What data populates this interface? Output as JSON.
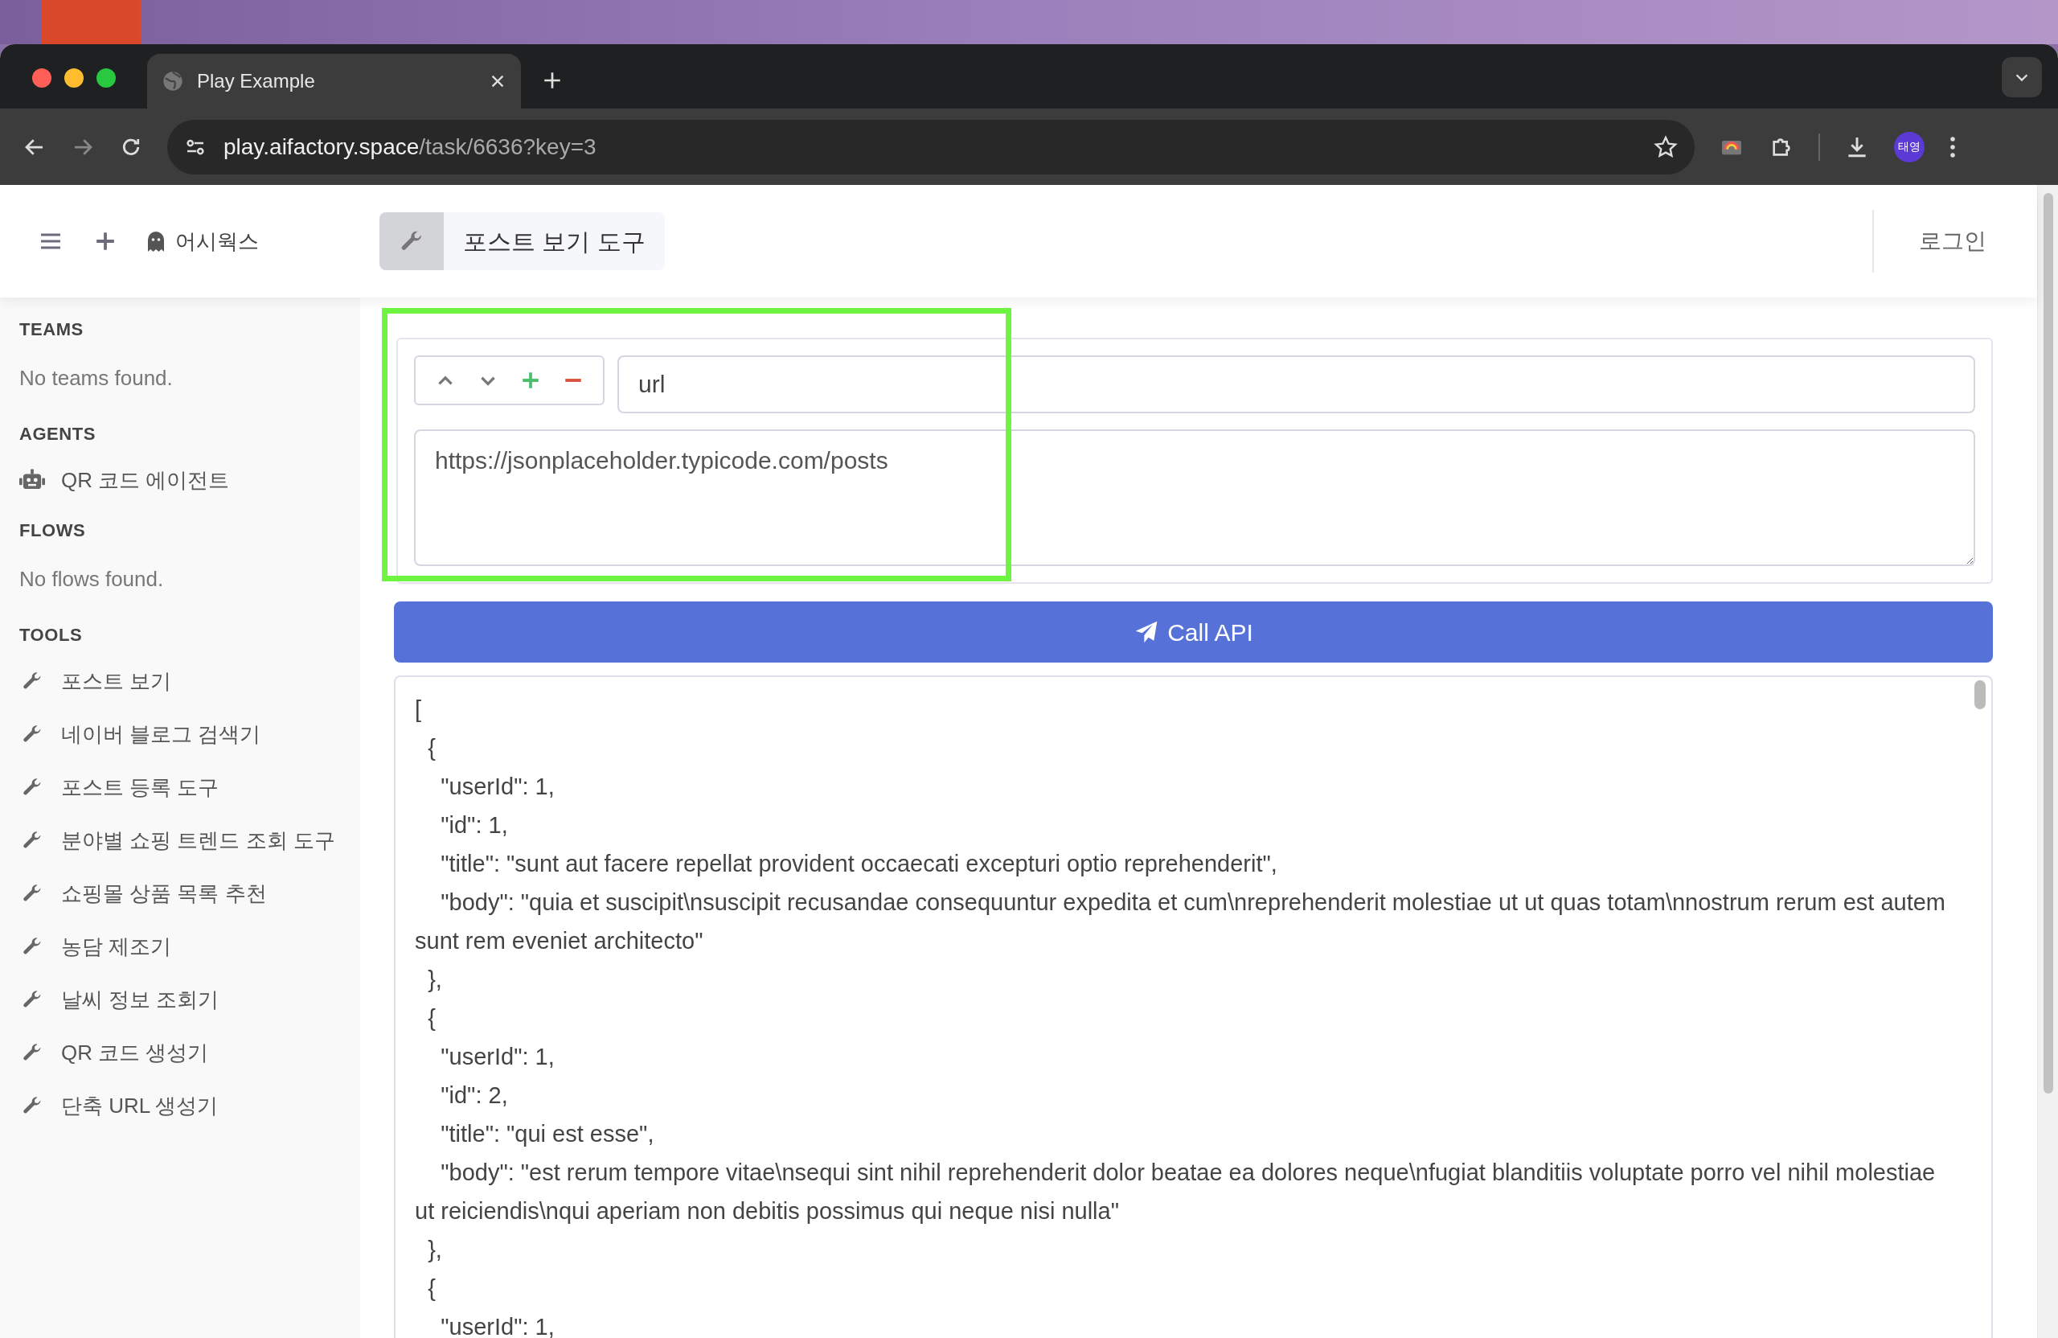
{
  "browser": {
    "tab": {
      "title": "Play Example"
    },
    "address": {
      "host": "play.aifactory.space",
      "path": "/task/6636?key=3"
    },
    "profile": "태영"
  },
  "header": {
    "workspace": "어시웍스",
    "title": "포스트 보기 도구",
    "login": "로그인"
  },
  "sidebar": {
    "sections": [
      {
        "kind": "empty",
        "heading": "TEAMS",
        "empty_text": "No teams found."
      },
      {
        "kind": "agents",
        "heading": "AGENTS",
        "items": [
          "QR 코드 에이전트"
        ]
      },
      {
        "kind": "empty",
        "heading": "FLOWS",
        "empty_text": "No flows found."
      },
      {
        "kind": "tools",
        "heading": "TOOLS",
        "items": [
          "포스트 보기",
          "네이버 블로그 검색기",
          "포스트 등록 도구",
          "분야별 쇼핑 트렌드 조회 도구",
          "쇼핑몰 상품 목록 추천",
          "농담 제조기",
          "날씨 정보 조회기",
          "QR 코드 생성기",
          "단축 URL 생성기"
        ]
      }
    ]
  },
  "parameter": {
    "name": "url",
    "value": "https://jsonplaceholder.typicode.com/posts"
  },
  "call_button": "Call API",
  "output": "[\n  {\n    \"userId\": 1,\n    \"id\": 1,\n    \"title\": \"sunt aut facere repellat provident occaecati excepturi optio reprehenderit\",\n    \"body\": \"quia et suscipit\\nsuscipit recusandae consequuntur expedita et cum\\nreprehenderit molestiae ut ut quas totam\\nnostrum rerum est autem sunt rem eveniet architecto\"\n  },\n  {\n    \"userId\": 1,\n    \"id\": 2,\n    \"title\": \"qui est esse\",\n    \"body\": \"est rerum tempore vitae\\nsequi sint nihil reprehenderit dolor beatae ea dolores neque\\nfugiat blanditiis voluptate porro vel nihil molestiae ut reiciendis\\nqui aperiam non debitis possimus qui neque nisi nulla\"\n  },\n  {\n    \"userId\": 1,"
}
